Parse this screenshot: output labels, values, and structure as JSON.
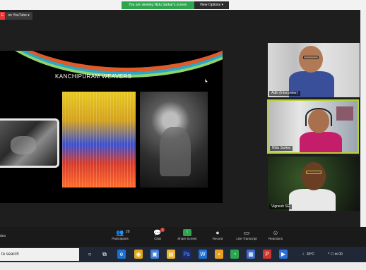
{
  "share_banner": {
    "message": "You are viewing Nidu Sarkar's screen",
    "view_options": "View Options ▾"
  },
  "youtube": {
    "live": "E",
    "on_youtube": "on YouTube ▾"
  },
  "slide": {
    "title": "KANCHIPURAM WEAVERS"
  },
  "participants": [
    {
      "name": "Aditi (Interpreter)",
      "speaking": false
    },
    {
      "name": "Nidu Sarkar",
      "speaking": true
    },
    {
      "name": "Vignesh SE",
      "speaking": false
    }
  ],
  "toolbar": {
    "left_label": "des",
    "participants_label": "Participants",
    "participants_count": "29",
    "chat_label": "Chat",
    "chat_badge": "1",
    "share_label": "Share Screen",
    "record_label": "Record",
    "transcript_label": "Live Transcript",
    "reactions_label": "Reactions"
  },
  "taskbar": {
    "search_placeholder": "to search",
    "temperature": "30°C",
    "tray_time": "00"
  },
  "colors": {
    "share_green": "#2da44e",
    "speaking_border": "#b5d334",
    "live_red": "#e53935"
  }
}
